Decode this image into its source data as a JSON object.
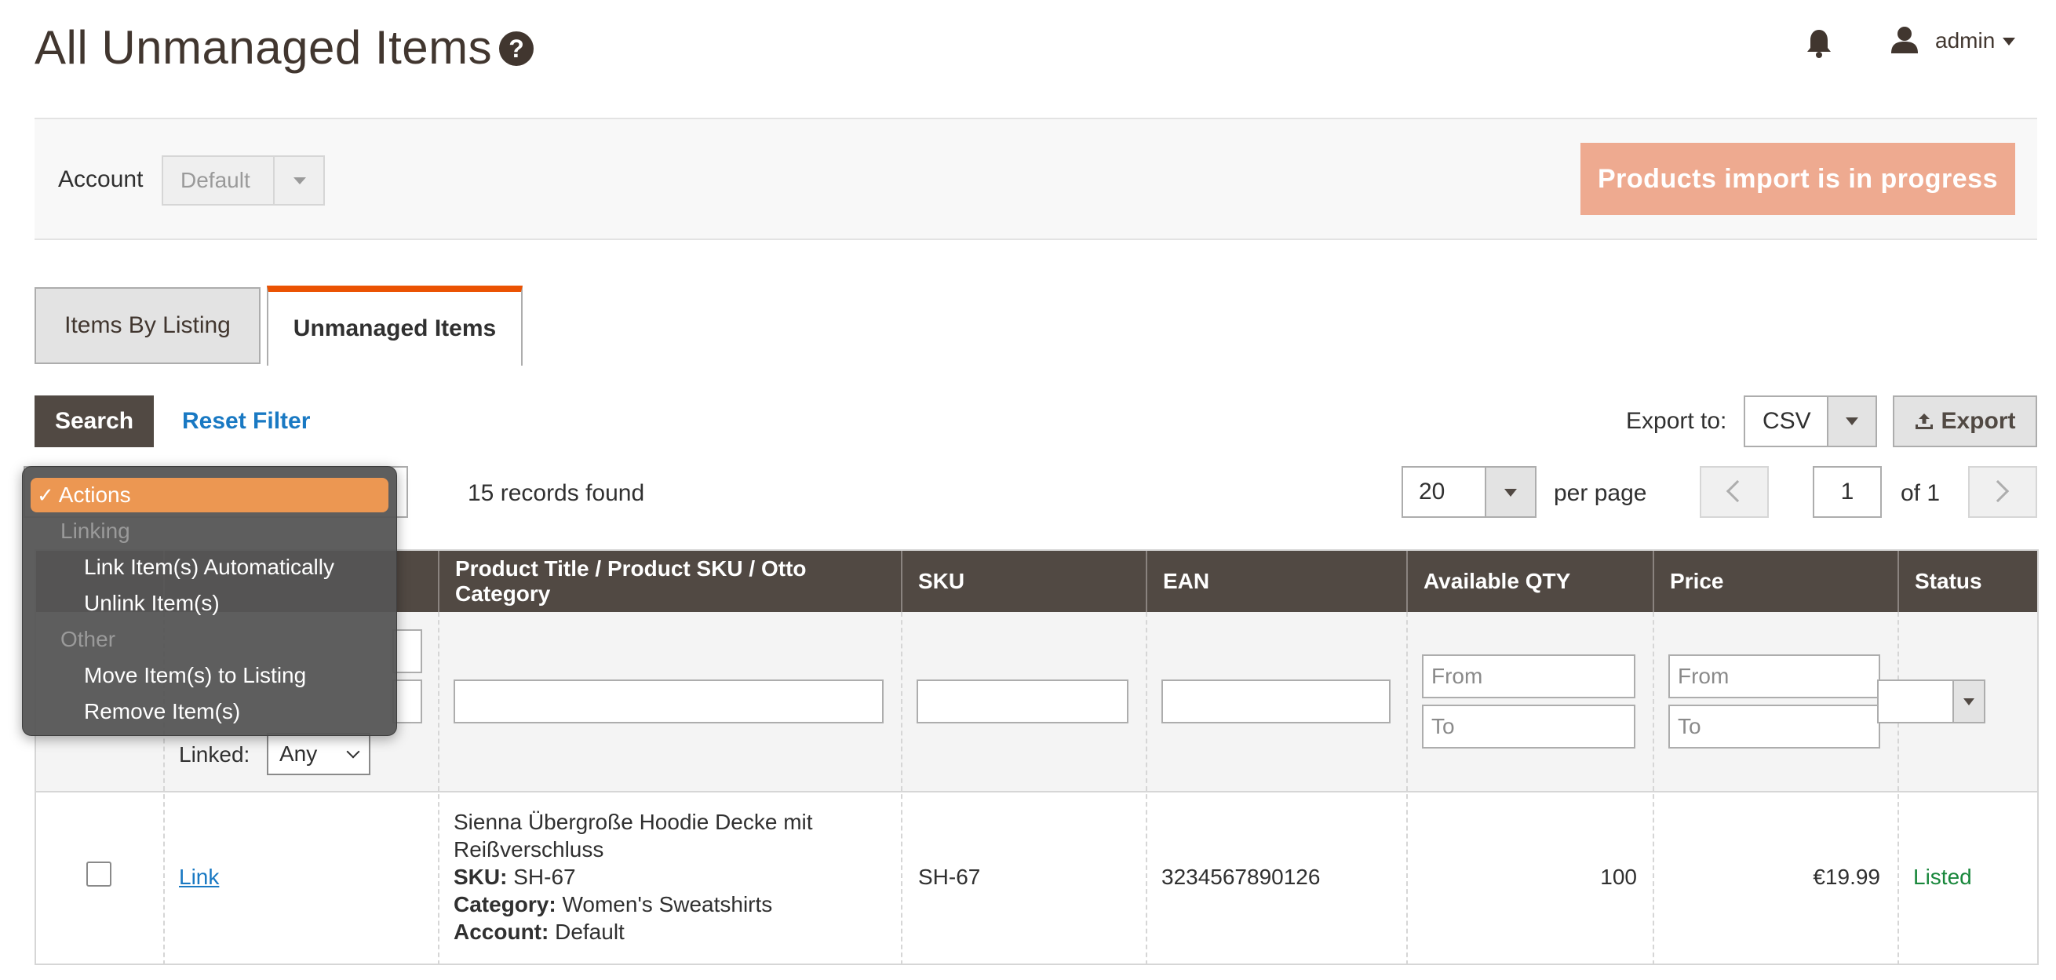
{
  "header": {
    "title": "All Unmanaged Items",
    "help_icon": "?",
    "user": "admin"
  },
  "account_bar": {
    "label": "Account",
    "selected": "Default",
    "import_status": "Products import is in progress"
  },
  "tabs": [
    {
      "label": "Items By Listing",
      "active": false
    },
    {
      "label": "Unmanaged Items",
      "active": true
    }
  ],
  "toolbar": {
    "search_label": "Search",
    "reset_label": "Reset Filter",
    "export_label": "Export to:",
    "export_format": "CSV",
    "export_button": "Export"
  },
  "grid_info": {
    "records": "15 records found",
    "per_page_value": "20",
    "per_page_label": "per page",
    "page": "1",
    "of_pages": "of 1"
  },
  "actions_menu": {
    "selected": "Actions",
    "groups": [
      {
        "label": "Linking",
        "items": [
          "Link Item(s) Automatically",
          "Unlink Item(s)"
        ]
      },
      {
        "label": "Other",
        "items": [
          "Move Item(s) to Listing",
          "Remove Item(s)"
        ]
      }
    ]
  },
  "columns": {
    "title": "Product Title / Product SKU / Otto Category",
    "sku": "SKU",
    "ean": "EAN",
    "qty": "Available QTY",
    "price": "Price",
    "status": "Status"
  },
  "filters": {
    "from_placeholder": "From",
    "to_placeholder": "To",
    "linked_label": "Linked:",
    "linked_value": "Any"
  },
  "rows": [
    {
      "link": "Link",
      "title": "Sienna Übergroße Hoodie Decke mit Reißverschluss",
      "sku_label": "SKU:",
      "sku_inline": "SH-67",
      "category_label": "Category:",
      "category": "Women's Sweatshirts",
      "account_label": "Account:",
      "account": "Default",
      "sku": "SH-67",
      "ean": "3234567890126",
      "qty": "100",
      "price": "€19.99",
      "status": "Listed"
    }
  ],
  "colors": {
    "header_bg": "#514943",
    "accent": "#eb5202",
    "import_button": "#eeaa90",
    "link": "#1979c3",
    "status_listed": "#18873b"
  }
}
